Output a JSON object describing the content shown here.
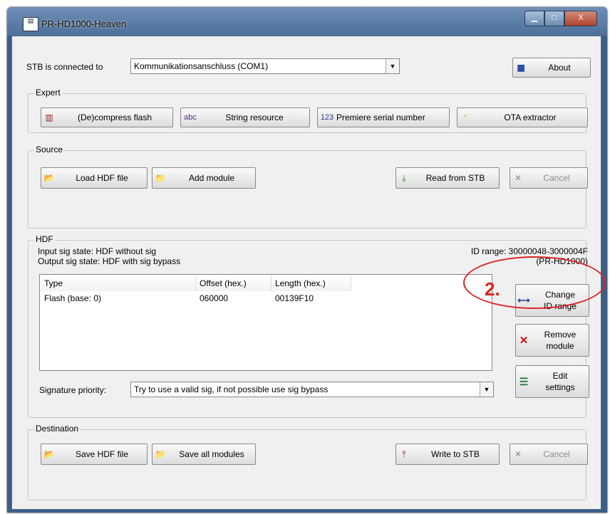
{
  "window": {
    "title": "PR-HD1000-Heaven",
    "app_icon": "app-icon",
    "minimize": "▁",
    "maximize": "□",
    "close": "X"
  },
  "connection": {
    "label": "STB is connected to",
    "value": "Kommunikationsanschluss (COM1)",
    "about_label": "About"
  },
  "expert": {
    "title": "Expert",
    "buttons": [
      {
        "icon_text": "▥",
        "label": "(De)compress flash"
      },
      {
        "icon_text": "abc",
        "label": "String resource"
      },
      {
        "icon_text": "123",
        "label": "Premiere serial number"
      },
      {
        "icon_text": "ᐟ",
        "label": "OTA extractor"
      }
    ]
  },
  "source": {
    "title": "Source",
    "load_label": "Load HDF file",
    "add_label": "Add module",
    "read_label": "Read from STB",
    "cancel_label": "Cancel"
  },
  "hdf": {
    "title": "HDF",
    "input_sig": "Input sig state: HDF without sig",
    "output_sig": "Output sig state: HDF with sig bypass",
    "id_range": "ID range: 30000048-3000004F",
    "model": "(PR-HD1000)",
    "columns": [
      "Type",
      "Offset (hex.)",
      "Length (hex.)"
    ],
    "rows": [
      {
        "type": "Flash (base: 0)",
        "offset": "060000",
        "length": "00139F10"
      }
    ],
    "change_line1": "Change",
    "change_line2": "ID range",
    "remove_line1": "Remove",
    "remove_line2": "module",
    "edit_line1": "Edit",
    "edit_line2": "settings",
    "sig_priority_label": "Signature priority:",
    "sig_priority_value": "Try to use a valid sig, if not possible use sig bypass"
  },
  "destination": {
    "title": "Destination",
    "save_label": "Save HDF file",
    "save_all_label": "Save all modules",
    "write_label": "Write to STB",
    "cancel_label": "Cancel"
  },
  "annotation": {
    "number": "2."
  },
  "colors": {
    "accent_red": "#dd2222",
    "titlebar": "#5a7ca6"
  }
}
